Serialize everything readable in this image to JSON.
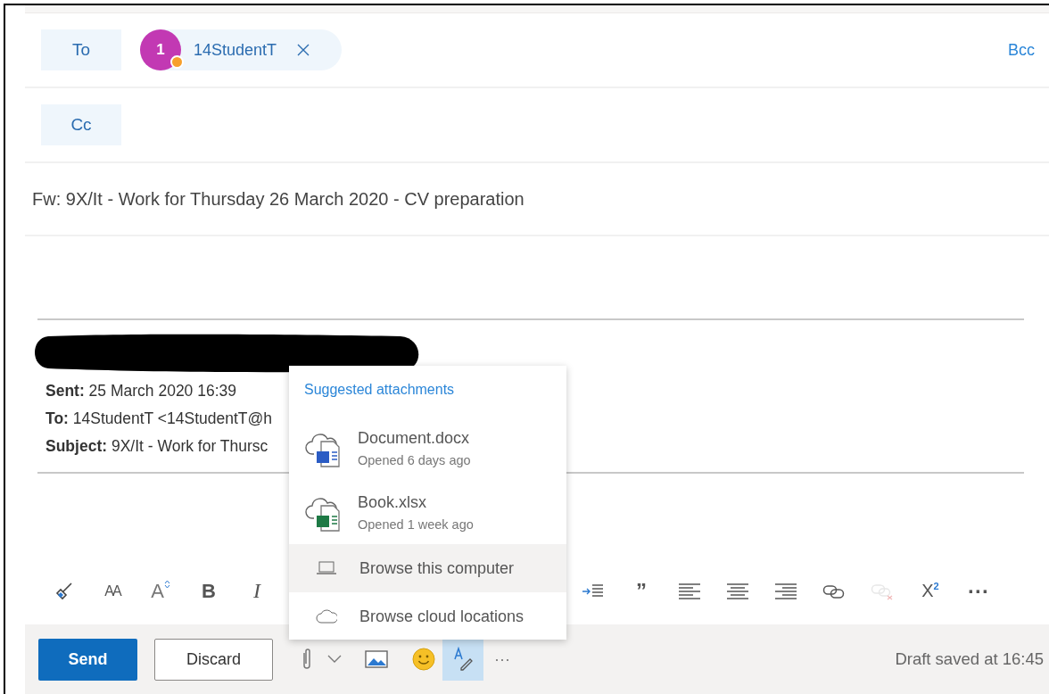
{
  "recipients": {
    "to_label": "To",
    "cc_label": "Cc",
    "bcc_label": "Bcc",
    "to": [
      {
        "initial": "1",
        "name": "14StudentT",
        "color": "#c239b3"
      }
    ]
  },
  "subject": {
    "value": "Fw: 9X/It - Work for Thursday 26 March 2020 - CV preparation"
  },
  "quoted_header": [
    "**Sent:** 25 March 2020 16:39",
    "**To:** 14StudentT <14StudentT@h",
    "**Subject:** 9X/It - Work for Thursc"
  ],
  "format_toolbar_left": [
    {
      "kind": "brush",
      "disabled": false
    },
    {
      "kind": "glyph",
      "text": "AA",
      "disabled": false
    },
    {
      "kind": "grow",
      "text": "A",
      "disabled": false
    },
    {
      "kind": "bold",
      "text": "B",
      "disabled": false
    },
    {
      "kind": "italic",
      "text": "I",
      "disabled": false
    }
  ],
  "format_toolbar_right": [
    {
      "kind": "indent",
      "disabled": false
    },
    {
      "kind": "glyph",
      "text": "”",
      "disabled": false
    },
    {
      "kind": "align-left",
      "disabled": false
    },
    {
      "kind": "align-center",
      "disabled": false
    },
    {
      "kind": "align-right",
      "disabled": false
    },
    {
      "kind": "link",
      "disabled": false
    },
    {
      "kind": "unlink",
      "disabled": true
    },
    {
      "kind": "superscript",
      "text": "X$^{2}$",
      "disabled": false
    },
    {
      "kind": "glyph",
      "text": "···",
      "disabled": false
    }
  ],
  "actions": {
    "send": "Send",
    "discard": "Discard",
    "more": "···",
    "editor_selected": true,
    "status": "Draft saved at 16:45"
  },
  "attachments_menu": {
    "title": "Suggested attachments",
    "files": [
      {
        "kind": "word",
        "name": "Document.docx",
        "opened": "Opened 6 days ago"
      },
      {
        "kind": "excel",
        "name": "Book.xlsx",
        "opened": "Opened 1 week ago"
      }
    ],
    "options": [
      {
        "kind": "computer",
        "label": "Browse this computer",
        "selected": true
      },
      {
        "kind": "cloud",
        "label": "Browse cloud locations",
        "selected": false
      }
    ]
  }
}
